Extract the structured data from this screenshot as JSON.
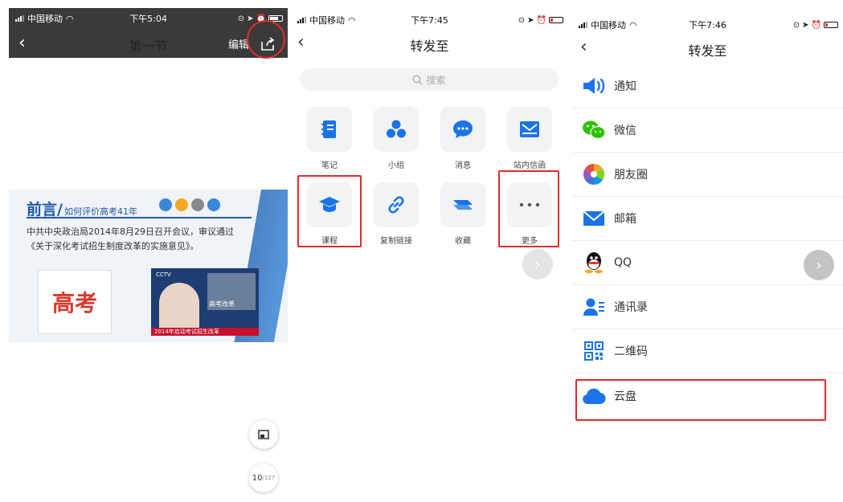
{
  "panel1": {
    "status": {
      "carrier": "中国移动",
      "time": "下午5:04"
    },
    "nav": {
      "title": "第一节",
      "edit": "编辑"
    },
    "slide": {
      "heading": "前言/",
      "subheading": "如何评价高考41年",
      "body": "中共中央政治局2014年8月29日召开会议，审议通过《关于深化考试招生制度改革的实施意见》。",
      "pic1_text": "高考",
      "pic2_logo": "CCTV",
      "pic2_inset_text": "高考改革",
      "pic2_ticker": "2014年启动考试招生改革"
    },
    "fab_page": {
      "current": "10",
      "total": "/127"
    }
  },
  "panel2": {
    "status": {
      "carrier": "中国移动",
      "time": "下午7:45"
    },
    "nav": {
      "title": "转发至"
    },
    "search_placeholder": "搜索",
    "grid": [
      {
        "label": "笔记",
        "icon": "notebook-icon",
        "color": "#1a73e8"
      },
      {
        "label": "小组",
        "icon": "group-icon",
        "color": "#1a73e8"
      },
      {
        "label": "消息",
        "icon": "message-icon",
        "color": "#1a73e8"
      },
      {
        "label": "站内信函",
        "icon": "mail-icon",
        "color": "#1a73e8"
      },
      {
        "label": "课程",
        "icon": "course-icon",
        "color": "#1a73e8"
      },
      {
        "label": "复制链接",
        "icon": "link-icon",
        "color": "#1a73e8"
      },
      {
        "label": "收藏",
        "icon": "collect-icon",
        "color": "#1a73e8"
      },
      {
        "label": "更多",
        "icon": "more-icon",
        "color": "#555555"
      }
    ]
  },
  "panel3": {
    "status": {
      "carrier": "中国移动",
      "time": "下午7:46"
    },
    "nav": {
      "title": "转发至"
    },
    "list": [
      {
        "label": "通知",
        "icon": "speaker-icon"
      },
      {
        "label": "微信",
        "icon": "wechat-icon"
      },
      {
        "label": "朋友圈",
        "icon": "moments-icon"
      },
      {
        "label": "邮箱",
        "icon": "email-icon"
      },
      {
        "label": "QQ",
        "icon": "qq-icon"
      },
      {
        "label": "通讯录",
        "icon": "contacts-icon"
      },
      {
        "label": "二维码",
        "icon": "qrcode-icon"
      },
      {
        "label": "云盘",
        "icon": "cloud-icon"
      }
    ]
  },
  "colors": {
    "accent": "#1a73e8",
    "highlight": "#e32b2b"
  }
}
